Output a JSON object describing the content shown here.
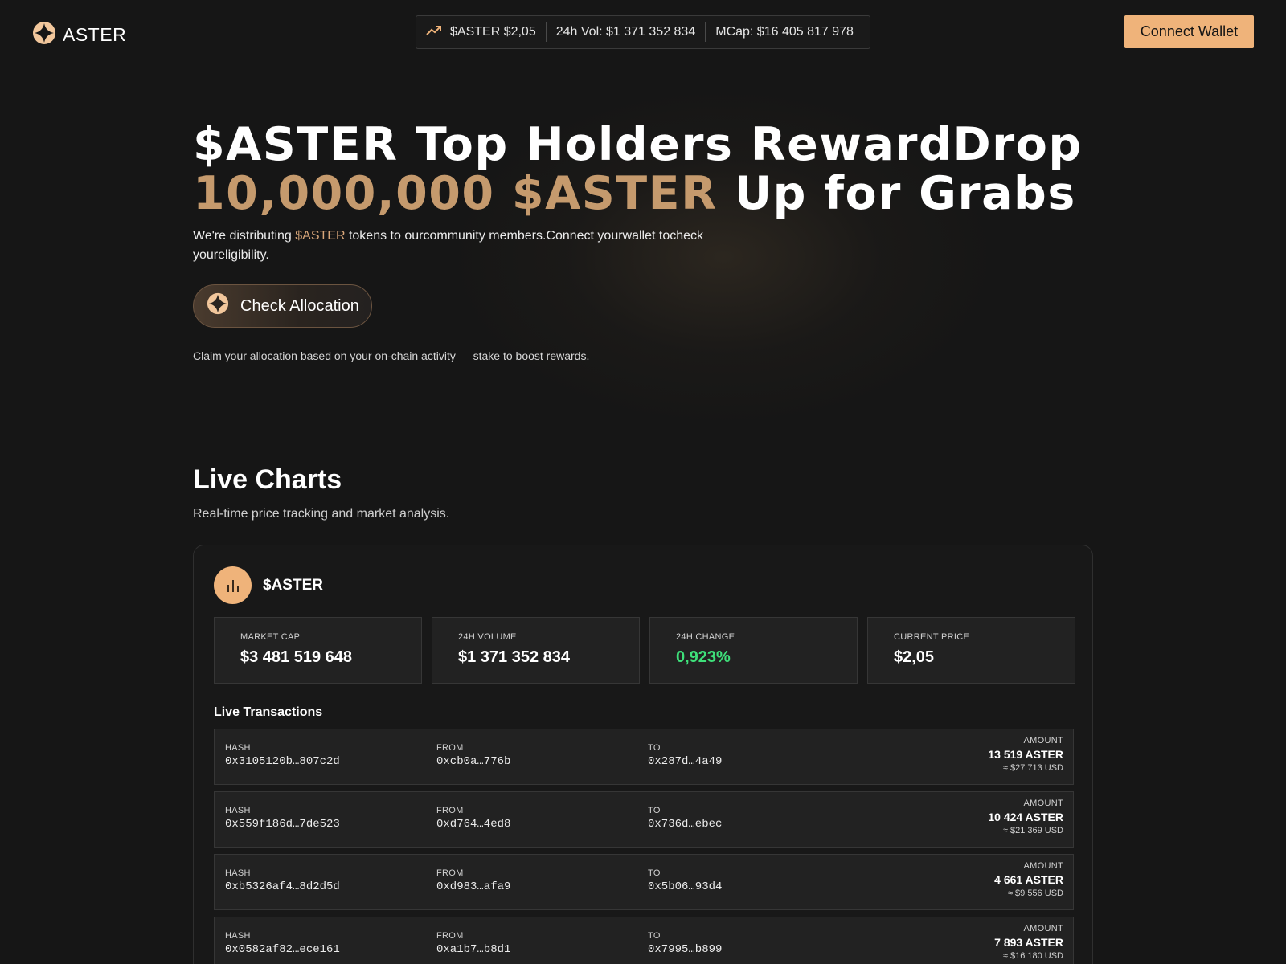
{
  "header": {
    "logo_text": "ASTER",
    "ticker": {
      "price": "$ASTER $2,05",
      "volume": "24h Vol: $1 371 352 834",
      "mcap": "MCap: $16 405 817 978"
    },
    "connect_label": "Connect Wallet"
  },
  "hero": {
    "title_line1": "$ASTER Top Holders RewardDrop",
    "title_line2_gold": "10,000,000 $ASTER",
    "title_line2_white": " Up for Grabs",
    "desc_before": "We're distributing ",
    "desc_highlight": "$ASTER",
    "desc_after": " tokens to ourcommunity members.Connect yourwallet tocheck youreligibility.",
    "check_label": "Check Allocation",
    "note": "Claim your  allocation based on your on-chain activity — stake to boost rewards."
  },
  "charts": {
    "title": "Live Charts",
    "subtitle": "Real-time price tracking and market analysis.",
    "token_name": "$ASTER",
    "stats": [
      {
        "label": "MARKET CAP",
        "value": "$3 481 519 648"
      },
      {
        "label": "24H VOLUME",
        "value": "$1 371 352 834"
      },
      {
        "label": "24H CHANGE",
        "value": "0,923%"
      },
      {
        "label": "CURRENT PRICE",
        "value": "$2,05"
      }
    ],
    "tx_title": "Live Transactions",
    "tx_labels": {
      "hash": "HASH",
      "from": "FROM",
      "to": "TO",
      "amount": "AMOUNT"
    },
    "transactions": [
      {
        "hash": "0x3105120b…807c2d",
        "from": "0xcb0a…776b",
        "to": "0x287d…4a49",
        "amount": "13 519 ASTER",
        "usd": "≈ $27 713 USD"
      },
      {
        "hash": "0x559f186d…7de523",
        "from": "0xd764…4ed8",
        "to": "0x736d…ebec",
        "amount": "10 424 ASTER",
        "usd": "≈ $21 369 USD"
      },
      {
        "hash": "0xb5326af4…8d2d5d",
        "from": "0xd983…afa9",
        "to": "0x5b06…93d4",
        "amount": "4 661 ASTER",
        "usd": "≈ $9 556 USD"
      },
      {
        "hash": "0x0582af82…ece161",
        "from": "0xa1b7…b8d1",
        "to": "0x7995…b899",
        "amount": "7 893 ASTER",
        "usd": "≈ $16 180 USD"
      }
    ]
  },
  "colors": {
    "accent": "#efb37a",
    "gold_text": "#c59a6d",
    "positive": "#3ee07a",
    "background": "#161616"
  },
  "icons": {
    "logo": "aster-star-icon",
    "ticker": "trending-up-icon",
    "token": "bar-chart-icon"
  }
}
